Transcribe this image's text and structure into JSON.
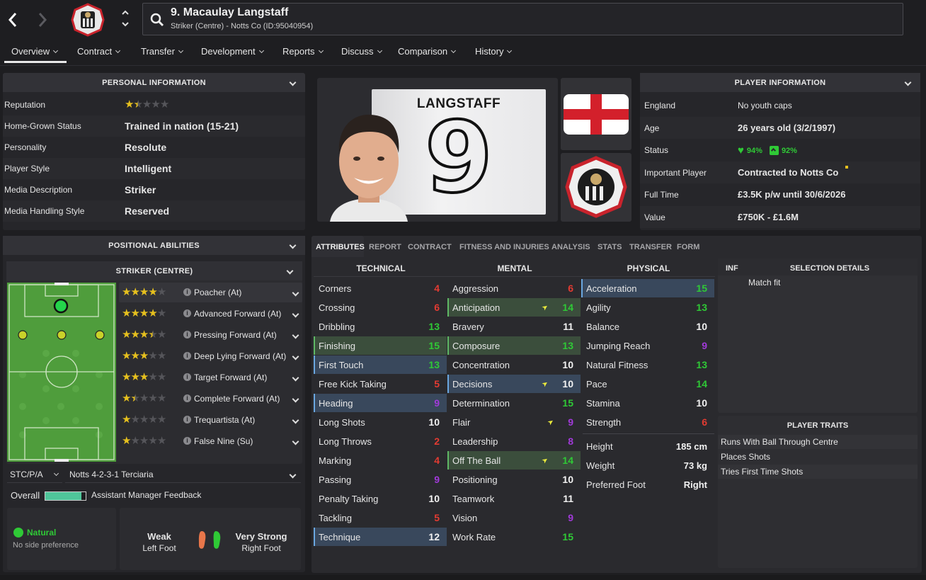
{
  "header": {
    "player_name": "9. Macaulay Langstaff",
    "player_sub": "Striker (Centre) - Notts Co (ID:95040954)"
  },
  "nav": {
    "items": [
      {
        "label": "Overview"
      },
      {
        "label": "Contract"
      },
      {
        "label": "Transfer"
      },
      {
        "label": "Development"
      },
      {
        "label": "Reports"
      },
      {
        "label": "Discuss"
      },
      {
        "label": "Comparison"
      },
      {
        "label": "History"
      }
    ]
  },
  "personal": {
    "title": "PERSONAL INFORMATION",
    "rows": [
      {
        "label": "Reputation",
        "value": "",
        "stars": 1.5
      },
      {
        "label": "Home-Grown Status",
        "value": "Trained in nation (15-21)"
      },
      {
        "label": "Personality",
        "value": "Resolute"
      },
      {
        "label": "Player Style",
        "value": "Intelligent"
      },
      {
        "label": "Media Description",
        "value": "Striker"
      },
      {
        "label": "Media Handling Style",
        "value": "Reserved"
      }
    ]
  },
  "kit": {
    "name": "LANGSTAFF",
    "number": "9"
  },
  "player_info": {
    "title": "PLAYER INFORMATION",
    "rows": [
      {
        "label": "England",
        "value": "No youth caps",
        "bold": false
      },
      {
        "label": "Age",
        "value": "26 years old (3/2/1997)",
        "bold": true
      },
      {
        "label": "Status",
        "value": "",
        "bold": false
      },
      {
        "label": "Important Player",
        "value": "Contracted to Notts Co",
        "bold": true
      },
      {
        "label": "Full Time",
        "value": "£3.5K p/w until 30/6/2026",
        "bold": true
      },
      {
        "label": "Value",
        "value": "£750K - £1.6M",
        "bold": true
      }
    ],
    "status_condition": "94%",
    "status_sharpness": "92%"
  },
  "positional": {
    "title": "POSITIONAL ABILITIES",
    "position": "STRIKER (CENTRE)",
    "roles": [
      {
        "stars": 4,
        "name": "Poacher (At)"
      },
      {
        "stars": 4,
        "name": "Advanced Forward (At)"
      },
      {
        "stars": 3.5,
        "name": "Pressing Forward (At)"
      },
      {
        "stars": 3,
        "name": "Deep Lying Forward (At)"
      },
      {
        "stars": 3,
        "name": "Target Forward (At)"
      },
      {
        "stars": 1.5,
        "name": "Complete Forward (At)"
      },
      {
        "stars": 1,
        "name": "Trequartista (At)"
      },
      {
        "stars": 1,
        "name": "False Nine (Su)"
      }
    ],
    "pos_select": "STC/P/A",
    "tactic_select": "Notts 4-2-3-1 Terciaria",
    "overall_label": "Overall",
    "feedback_label": "Assistant Manager Feedback",
    "overall_level": 0.9
  },
  "side": {
    "label": "Natural",
    "sub": "No side preference"
  },
  "foot": {
    "left_word": "Weak",
    "left_label": "Left Foot",
    "right_word": "Very Strong",
    "right_label": "Right Foot"
  },
  "tabs": [
    {
      "label": "ATTRIBUTES"
    },
    {
      "label": "REPORT"
    },
    {
      "label": "CONTRACT"
    },
    {
      "label": "FITNESS AND INJURIES"
    },
    {
      "label": "ANALYSIS"
    },
    {
      "label": "STATS"
    },
    {
      "label": "TRANSFER"
    },
    {
      "label": "FORM"
    }
  ],
  "attributes": {
    "technical": {
      "title": "TECHNICAL",
      "items": [
        {
          "name": "Corners",
          "value": "4",
          "color": "#e33b32"
        },
        {
          "name": "Crossing",
          "value": "6",
          "color": "#e33b32"
        },
        {
          "name": "Dribbling",
          "value": "13",
          "color": "#2fc936"
        },
        {
          "name": "Finishing",
          "value": "15",
          "color": "#2fc936",
          "hl": "g"
        },
        {
          "name": "First Touch",
          "value": "13",
          "color": "#2fc936",
          "hl": "b"
        },
        {
          "name": "Free Kick Taking",
          "value": "5",
          "color": "#e33b32"
        },
        {
          "name": "Heading",
          "value": "9",
          "color": "#a13ad9",
          "hl": "b"
        },
        {
          "name": "Long Shots",
          "value": "10",
          "color": "#f2f2f2"
        },
        {
          "name": "Long Throws",
          "value": "2",
          "color": "#e33b32"
        },
        {
          "name": "Marking",
          "value": "4",
          "color": "#e33b32"
        },
        {
          "name": "Passing",
          "value": "9",
          "color": "#a13ad9"
        },
        {
          "name": "Penalty Taking",
          "value": "10",
          "color": "#f2f2f2"
        },
        {
          "name": "Tackling",
          "value": "5",
          "color": "#e33b32"
        },
        {
          "name": "Technique",
          "value": "12",
          "color": "#f2f2f2",
          "hl": "b"
        }
      ]
    },
    "mental": {
      "title": "MENTAL",
      "items": [
        {
          "name": "Aggression",
          "value": "6",
          "color": "#e33b32"
        },
        {
          "name": "Anticipation",
          "value": "14",
          "color": "#2fc936",
          "hl": "g",
          "up": true
        },
        {
          "name": "Bravery",
          "value": "11",
          "color": "#f2f2f2"
        },
        {
          "name": "Composure",
          "value": "13",
          "color": "#2fc936",
          "hl": "g"
        },
        {
          "name": "Concentration",
          "value": "10",
          "color": "#f2f2f2"
        },
        {
          "name": "Decisions",
          "value": "10",
          "color": "#f2f2f2",
          "hl": "b",
          "up": true
        },
        {
          "name": "Determination",
          "value": "15",
          "color": "#2fc936"
        },
        {
          "name": "Flair",
          "value": "9",
          "color": "#a13ad9",
          "up": true
        },
        {
          "name": "Leadership",
          "value": "8",
          "color": "#a13ad9"
        },
        {
          "name": "Off The Ball",
          "value": "14",
          "color": "#2fc936",
          "hl": "g",
          "up": true
        },
        {
          "name": "Positioning",
          "value": "10",
          "color": "#f2f2f2"
        },
        {
          "name": "Teamwork",
          "value": "11",
          "color": "#f2f2f2"
        },
        {
          "name": "Vision",
          "value": "9",
          "color": "#a13ad9"
        },
        {
          "name": "Work Rate",
          "value": "15",
          "color": "#2fc936"
        }
      ]
    },
    "physical": {
      "title": "PHYSICAL",
      "items": [
        {
          "name": "Acceleration",
          "value": "15",
          "color": "#2fc936",
          "hl": "b"
        },
        {
          "name": "Agility",
          "value": "13",
          "color": "#2fc936"
        },
        {
          "name": "Balance",
          "value": "10",
          "color": "#f2f2f2"
        },
        {
          "name": "Jumping Reach",
          "value": "9",
          "color": "#a13ad9"
        },
        {
          "name": "Natural Fitness",
          "value": "13",
          "color": "#2fc936"
        },
        {
          "name": "Pace",
          "value": "14",
          "color": "#2fc936"
        },
        {
          "name": "Stamina",
          "value": "10",
          "color": "#f2f2f2"
        },
        {
          "name": "Strength",
          "value": "6",
          "color": "#e33b32"
        }
      ],
      "extras": [
        {
          "name": "Height",
          "value": "185 cm"
        },
        {
          "name": "Weight",
          "value": "73 kg"
        },
        {
          "name": "Preferred Foot",
          "value": "Right"
        }
      ]
    }
  },
  "selection": {
    "inf": "INF",
    "title": "SELECTION DETAILS",
    "match_fit": "Match fit"
  },
  "traits": {
    "title": "PLAYER TRAITS",
    "items": [
      "Runs With Ball Through Centre",
      "Places Shots",
      "Tries First Time Shots"
    ]
  },
  "colors": {
    "green": "#2fc936",
    "red": "#e33b32",
    "purple": "#a13ad9",
    "accent": "#4fc59a"
  }
}
